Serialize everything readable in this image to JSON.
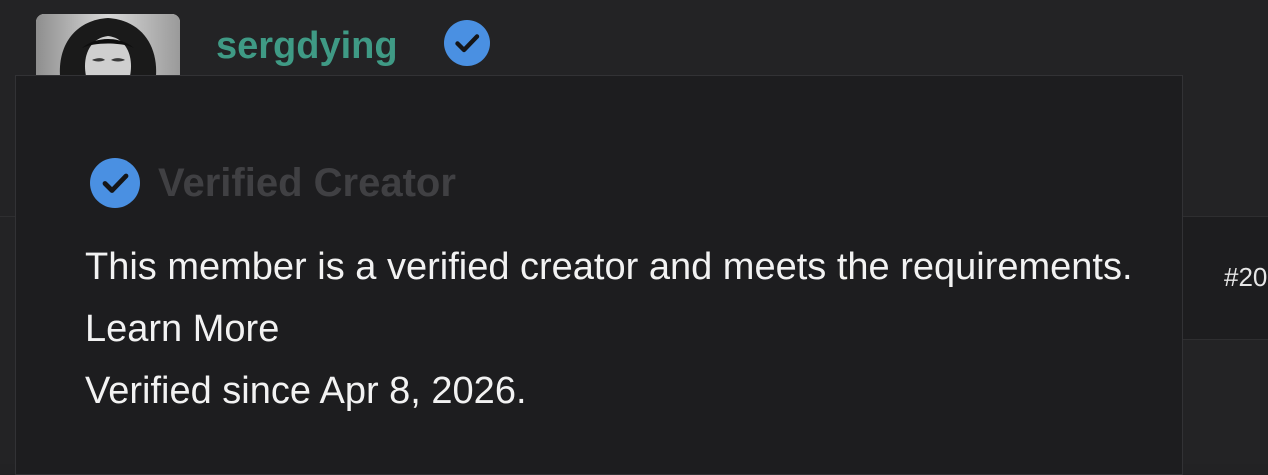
{
  "post": {
    "author": {
      "username": "sergdying",
      "avatar_icon": "avatar-photo"
    },
    "number_label": "#20"
  },
  "badge": {
    "icon": "verified-check-icon",
    "color": "#4a90e2"
  },
  "popover": {
    "title": "Verified Creator",
    "description": "This member is a verified creator and meets the requirements.",
    "link_text": "Learn More",
    "verified_since": "Verified since Apr 8, 2026."
  },
  "colors": {
    "username": "#3f9a85",
    "badge": "#4a90e2",
    "popover_bg": "#1d1d1f",
    "title_text": "#404043",
    "body_text": "#f2f2f2"
  }
}
